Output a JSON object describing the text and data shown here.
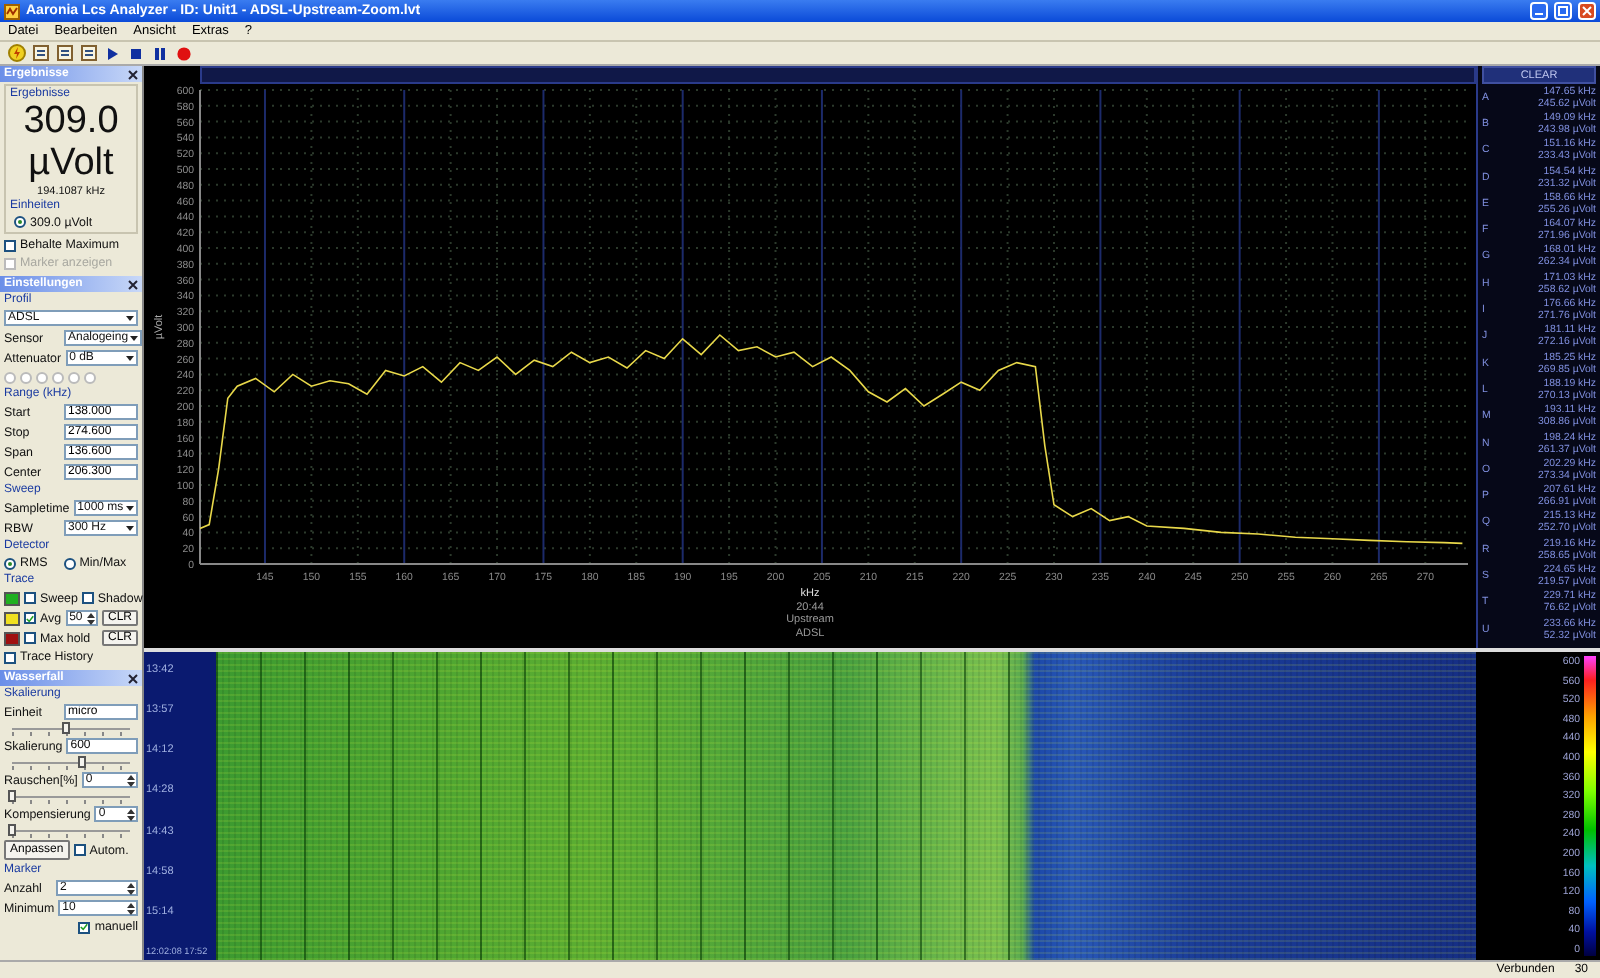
{
  "window": {
    "title": "Aaronia Lcs Analyzer - ID: Unit1 - ADSL-Upstream-Zoom.lvt"
  },
  "menu": [
    "Datei",
    "Bearbeiten",
    "Ansicht",
    "Extras",
    "?"
  ],
  "results_panel": {
    "header": "Ergebnisse",
    "group": "Ergebnisse",
    "value": "309.0",
    "unit": "µVolt",
    "frequency": "194.1087 kHz",
    "units_label": "Einheiten",
    "unit_options": [
      {
        "label": "309.0 µVolt",
        "selected": true
      }
    ],
    "checks": [
      {
        "label": "Behalte Maximum",
        "checked": false,
        "disabled": false
      },
      {
        "label": "Marker anzeigen",
        "checked": false,
        "disabled": true
      }
    ]
  },
  "settings_panel": {
    "header": "Einstellungen",
    "rows": [
      {
        "kind": "heading",
        "text": "Profil"
      },
      {
        "kind": "select",
        "value": "ADSL"
      },
      {
        "kind": "select",
        "label": "Sensor",
        "value": "Analogeing"
      },
      {
        "kind": "select",
        "label": "Attenuator",
        "value": "0 dB"
      },
      {
        "kind": "radios",
        "options": [
          {
            "selected": false,
            "disabled": true
          },
          {
            "selected": false,
            "disabled": true
          },
          {
            "selected": false,
            "disabled": true
          },
          {
            "selected": false,
            "disabled": true
          },
          {
            "selected": false,
            "disabled": true
          },
          {
            "selected": false,
            "disabled": true
          }
        ]
      },
      {
        "kind": "heading",
        "text": "Range (kHz)"
      },
      {
        "kind": "field",
        "label": "Start",
        "value": "138.000"
      },
      {
        "kind": "field",
        "label": "Stop",
        "value": "274.600"
      },
      {
        "kind": "field",
        "label": "Span",
        "value": "136.600"
      },
      {
        "kind": "field",
        "label": "Center",
        "value": "206.300"
      },
      {
        "kind": "heading",
        "text": "Sweep"
      },
      {
        "kind": "select",
        "label": "Sampletime",
        "value": "1000 ms"
      },
      {
        "kind": "select",
        "label": "RBW",
        "value": "300 Hz"
      },
      {
        "kind": "heading",
        "text": "Detector"
      },
      {
        "kind": "radios",
        "options": [
          {
            "label": "RMS",
            "selected": true,
            "disabled": false
          },
          {
            "label": "Min/Max",
            "selected": false,
            "disabled": false
          }
        ]
      },
      {
        "kind": "heading",
        "text": "Trace"
      },
      {
        "kind": "trace",
        "color": "#20b020",
        "checked": false,
        "label": "Sweep",
        "extra_check": {
          "label": "Shadow",
          "checked": false
        }
      },
      {
        "kind": "trace",
        "color": "#f0e020",
        "checked": true,
        "label": "Avg",
        "spin": "50",
        "button": "CLR"
      },
      {
        "kind": "trace",
        "color": "#a01010",
        "checked": false,
        "label": "Max hold",
        "button": "CLR"
      },
      {
        "kind": "check",
        "label": "Trace History",
        "checked": false
      }
    ]
  },
  "waterfall_panel": {
    "header": "Wasserfall",
    "rows": [
      {
        "kind": "heading",
        "text": "Skalierung"
      },
      {
        "kind": "field",
        "label": "Einheit",
        "value": "micro"
      },
      {
        "kind": "slider",
        "level": 0.45
      },
      {
        "kind": "field",
        "label": "Skalierung",
        "value": "600"
      },
      {
        "kind": "slider",
        "level": 0.6
      },
      {
        "kind": "spin",
        "label": "Rauschen[%]",
        "value": "0"
      },
      {
        "kind": "slider",
        "level": 0
      },
      {
        "kind": "spin",
        "label": "Kompensierung",
        "value": "0"
      },
      {
        "kind": "slider",
        "level": 0
      },
      {
        "kind": "button_check",
        "button": "Anpassen",
        "check": {
          "label": "Autom.",
          "checked": false
        }
      },
      {
        "kind": "heading",
        "text": "Marker"
      },
      {
        "kind": "spin",
        "label": "Anzahl",
        "value": "2"
      },
      {
        "kind": "spin",
        "label": "Minimum",
        "value": "10"
      },
      {
        "kind": "rightcheck",
        "label": "manuell",
        "checked": true
      }
    ]
  },
  "spectrum": {
    "captions": [
      "20:44",
      "Upstream",
      "ADSL"
    ],
    "chart_data": {
      "type": "line",
      "grid": true,
      "xlabel": "kHz",
      "ylabel": "µVolt",
      "xlim": [
        138,
        274.6
      ],
      "ylim": [
        0,
        600
      ],
      "x": [
        138,
        139,
        140,
        141,
        142,
        144,
        146,
        148,
        150,
        152,
        154,
        156,
        158,
        160,
        162,
        164,
        166,
        168,
        170,
        172,
        174,
        176,
        178,
        180,
        182,
        184,
        186,
        188,
        190,
        192,
        194,
        196,
        198,
        200,
        202,
        204,
        206,
        208,
        210,
        212,
        214,
        216,
        218,
        220,
        222,
        224,
        226,
        228,
        229,
        230,
        232,
        234,
        236,
        238,
        240,
        244,
        248,
        252,
        256,
        260,
        264,
        268,
        272,
        274
      ],
      "series": [
        {
          "color": "#e8d84a",
          "values": [
            45,
            50,
            120,
            210,
            225,
            235,
            218,
            240,
            225,
            232,
            228,
            215,
            245,
            238,
            250,
            230,
            255,
            245,
            262,
            240,
            258,
            250,
            268,
            255,
            262,
            248,
            270,
            260,
            285,
            265,
            290,
            270,
            275,
            262,
            268,
            250,
            262,
            245,
            218,
            205,
            222,
            200,
            215,
            230,
            220,
            245,
            255,
            250,
            150,
            75,
            60,
            70,
            55,
            60,
            48,
            45,
            40,
            38,
            34,
            32,
            30,
            28,
            27,
            26
          ]
        }
      ],
      "xticks": [
        145,
        150,
        155,
        160,
        165,
        170,
        175,
        180,
        185,
        190,
        195,
        200,
        205,
        210,
        215,
        220,
        225,
        230,
        235,
        240,
        245,
        250,
        255,
        260,
        265,
        270
      ],
      "yticks": [
        0,
        20,
        40,
        60,
        80,
        100,
        120,
        140,
        160,
        180,
        200,
        220,
        240,
        260,
        280,
        300,
        320,
        340,
        360,
        380,
        400,
        420,
        440,
        460,
        480,
        500,
        520,
        540,
        560,
        580,
        600
      ]
    }
  },
  "markers": {
    "clear_button": "CLEAR",
    "items": [
      {
        "letter": "A",
        "frequency": "147.65 kHz",
        "value": "245.62 µVolt"
      },
      {
        "letter": "B",
        "frequency": "149.09 kHz",
        "value": "243.98 µVolt"
      },
      {
        "letter": "C",
        "frequency": "151.16 kHz",
        "value": "233.43 µVolt"
      },
      {
        "letter": "D",
        "frequency": "154.54 kHz",
        "value": "231.32 µVolt"
      },
      {
        "letter": "E",
        "frequency": "158.66 kHz",
        "value": "255.26 µVolt"
      },
      {
        "letter": "F",
        "frequency": "164.07 kHz",
        "value": "271.96 µVolt"
      },
      {
        "letter": "G",
        "frequency": "168.01 kHz",
        "value": "262.34 µVolt"
      },
      {
        "letter": "H",
        "frequency": "171.03 kHz",
        "value": "258.62 µVolt"
      },
      {
        "letter": "I",
        "frequency": "176.66 kHz",
        "value": "271.76 µVolt"
      },
      {
        "letter": "J",
        "frequency": "181.11 kHz",
        "value": "272.16 µVolt"
      },
      {
        "letter": "K",
        "frequency": "185.25 kHz",
        "value": "269.85 µVolt"
      },
      {
        "letter": "L",
        "frequency": "188.19 kHz",
        "value": "270.13 µVolt"
      },
      {
        "letter": "M",
        "frequency": "193.11 kHz",
        "value": "308.86 µVolt"
      },
      {
        "letter": "N",
        "frequency": "198.24 kHz",
        "value": "261.37 µVolt"
      },
      {
        "letter": "O",
        "frequency": "202.29 kHz",
        "value": "273.34 µVolt"
      },
      {
        "letter": "P",
        "frequency": "207.61 kHz",
        "value": "266.91 µVolt"
      },
      {
        "letter": "Q",
        "frequency": "215.13 kHz",
        "value": "252.70 µVolt"
      },
      {
        "letter": "R",
        "frequency": "219.16 kHz",
        "value": "258.65 µVolt"
      },
      {
        "letter": "S",
        "frequency": "224.65 kHz",
        "value": "219.57 µVolt"
      },
      {
        "letter": "T",
        "frequency": "229.71 kHz",
        "value": "76.62 µVolt"
      },
      {
        "letter": "U",
        "frequency": "233.66 kHz",
        "value": "52.32 µVolt"
      }
    ]
  },
  "waterfall": {
    "times": [
      "13:42",
      "13:57",
      "14:12",
      "14:28",
      "14:43",
      "14:58",
      "15:14"
    ],
    "start_time": "12:02:08 17:52",
    "scale": [
      "600",
      "560",
      "520",
      "480",
      "440",
      "400",
      "360",
      "320",
      "280",
      "240",
      "200",
      "160",
      "120",
      "80",
      "40",
      "0"
    ]
  },
  "status_bar": [
    "Verbunden",
    "30"
  ]
}
